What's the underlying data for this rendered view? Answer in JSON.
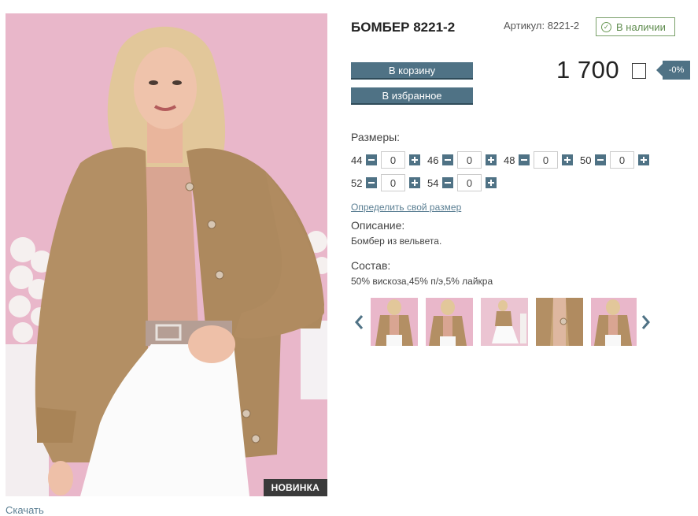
{
  "product": {
    "title": "БОМБЕР 8221-2",
    "article": "Артикул: 8221-2",
    "stock": "В наличии",
    "price": "1 700",
    "discount": "-0%",
    "badge": "НОВИНКА",
    "below_photo": "Скачать"
  },
  "buttons": {
    "cart": "В корзину",
    "favorite": "В избранное"
  },
  "sizes": {
    "label": "Размеры:",
    "rows": [
      [
        {
          "size": "44",
          "qty": "0"
        },
        {
          "size": "46",
          "qty": "0"
        },
        {
          "size": "48",
          "qty": "0"
        },
        {
          "size": "50",
          "qty": "0"
        }
      ],
      [
        {
          "size": "52",
          "qty": "0"
        },
        {
          "size": "54",
          "qty": "0"
        }
      ]
    ],
    "find_size_link": "Определить свой размер"
  },
  "description": {
    "label": "Описание:",
    "text": "Бомбер из вельвета."
  },
  "composition": {
    "label": "Состав:",
    "text": "50% вискоза,45% п/э,5% лайкра"
  },
  "icons": {
    "prev": "chevron-left-icon",
    "next": "chevron-right-icon",
    "stock": "check-circle-icon",
    "currency": "currency-icon"
  },
  "colors": {
    "accent": "#4f7285",
    "stock": "#5f8c4e",
    "link": "#5b7f93",
    "photo_bg": "#e9b7ca",
    "jacket": "#b38f64"
  }
}
